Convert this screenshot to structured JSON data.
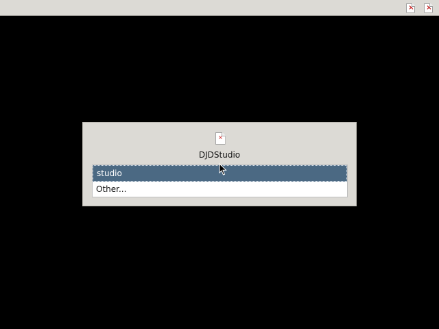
{
  "window": {
    "top_buttons": [
      {
        "icon": "broken-image-icon"
      },
      {
        "icon": "broken-image-icon"
      }
    ]
  },
  "dialog": {
    "icon": "broken-document-icon",
    "title": "DJDStudio",
    "items": [
      {
        "label": "studio",
        "selected": true
      },
      {
        "label": "Other..."
      }
    ]
  },
  "pointer": {
    "icon": "mouse-pointer-icon"
  }
}
